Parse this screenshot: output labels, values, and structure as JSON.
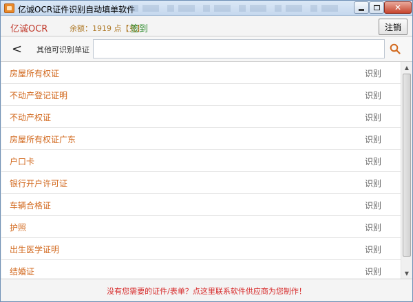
{
  "titlebar": {
    "title": "亿诚OCR证件识别自动填单软件"
  },
  "header": {
    "brand": "亿诚OCR",
    "balance": "余额：1919 点【充】",
    "checkin_label": "签到",
    "logout_label": "注销"
  },
  "search": {
    "back_glyph": "<",
    "label": "其他可识别单证",
    "value": "",
    "placeholder": ""
  },
  "list": {
    "items": [
      {
        "name": "房屋所有权证",
        "action": "识别"
      },
      {
        "name": "不动产登记证明",
        "action": "识别"
      },
      {
        "name": "不动产权证",
        "action": "识别"
      },
      {
        "name": "房屋所有权证广东",
        "action": "识别"
      },
      {
        "name": "户口卡",
        "action": "识别"
      },
      {
        "name": "银行开户许可证",
        "action": "识别"
      },
      {
        "name": "车辆合格证",
        "action": "识别"
      },
      {
        "name": "护照",
        "action": "识别"
      },
      {
        "name": "出生医学证明",
        "action": "识别"
      },
      {
        "name": "结婚证",
        "action": "识别"
      }
    ]
  },
  "footer": {
    "link_text": "没有您需要的证件/表单？点这里联系软件供应商为您制作！"
  },
  "colors": {
    "item_text": "#d2691e",
    "brand": "#c0392b",
    "checkin": "#2e8b2e",
    "footer_link": "#d62828"
  }
}
